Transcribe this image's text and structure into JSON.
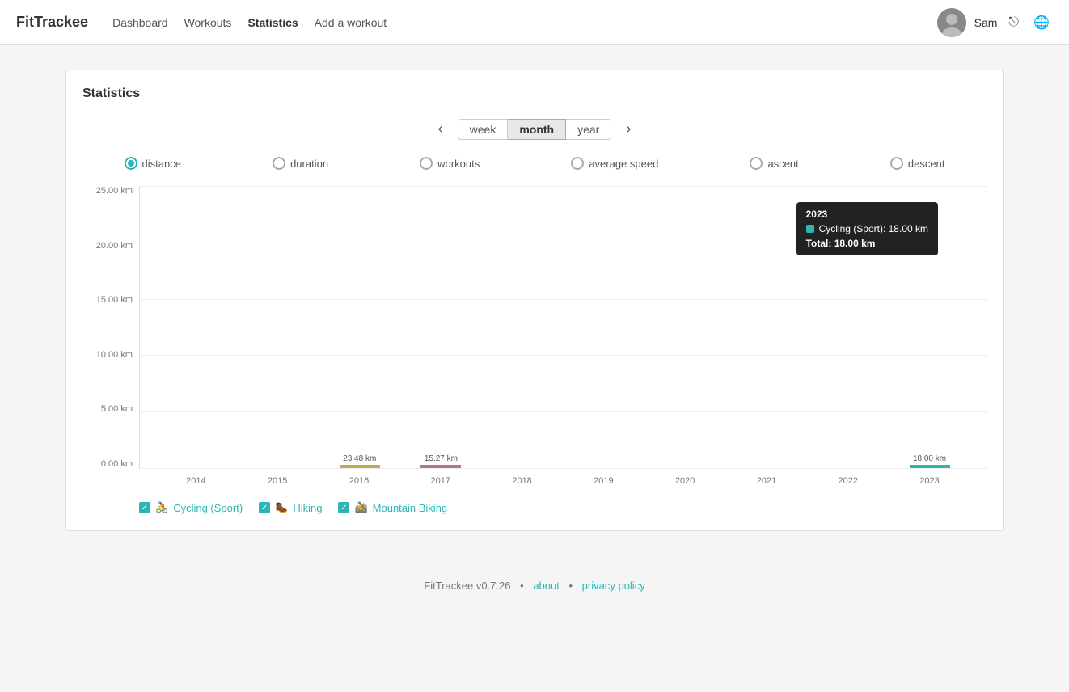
{
  "app": {
    "brand": "FitTrackee",
    "nav_links": [
      {
        "label": "Dashboard",
        "active": false
      },
      {
        "label": "Workouts",
        "active": false
      },
      {
        "label": "Statistics",
        "active": true
      },
      {
        "label": "Add a workout",
        "active": false
      }
    ],
    "user": "Sam"
  },
  "page": {
    "title": "Statistics"
  },
  "time_nav": {
    "prev_label": "‹",
    "next_label": "›",
    "buttons": [
      {
        "label": "week",
        "active": false
      },
      {
        "label": "month",
        "active": true
      },
      {
        "label": "year",
        "active": false
      }
    ]
  },
  "metrics": [
    {
      "id": "distance",
      "label": "distance",
      "selected": true
    },
    {
      "id": "duration",
      "label": "duration",
      "selected": false
    },
    {
      "id": "workouts",
      "label": "workouts",
      "selected": false
    },
    {
      "id": "average_speed",
      "label": "average speed",
      "selected": false
    },
    {
      "id": "ascent",
      "label": "ascent",
      "selected": false
    },
    {
      "id": "descent",
      "label": "descent",
      "selected": false
    }
  ],
  "chart": {
    "y_labels": [
      "25.00 km",
      "20.00 km",
      "15.00 km",
      "10.00 km",
      "5.00 km",
      "0.00 km"
    ],
    "x_labels": [
      "2014",
      "2015",
      "2016",
      "2017",
      "2018",
      "2019",
      "2020",
      "2021",
      "2022",
      "2023"
    ],
    "bars": [
      {
        "year": "2014",
        "value": 0,
        "color": "",
        "label": ""
      },
      {
        "year": "2015",
        "value": 0,
        "color": "",
        "label": ""
      },
      {
        "year": "2016",
        "value": 23.48,
        "color": "#c8a84b",
        "label": "23.48 km"
      },
      {
        "year": "2017",
        "value": 15.27,
        "color": "#b5748a",
        "label": "15.27 km"
      },
      {
        "year": "2018",
        "value": 0,
        "color": "",
        "label": ""
      },
      {
        "year": "2019",
        "value": 0,
        "color": "",
        "label": ""
      },
      {
        "year": "2020",
        "value": 0,
        "color": "",
        "label": ""
      },
      {
        "year": "2021",
        "value": 0,
        "color": "",
        "label": ""
      },
      {
        "year": "2022",
        "value": 0,
        "color": "",
        "label": ""
      },
      {
        "year": "2023",
        "value": 18,
        "color": "#2db5b5",
        "label": "18.00 km"
      }
    ],
    "max_value": 25,
    "tooltip": {
      "year": "2023",
      "rows": [
        {
          "color": "#2db5b5",
          "label": "Cycling (Sport): 18.00 km"
        }
      ],
      "total": "Total: 18.00 km"
    }
  },
  "legend": [
    {
      "label": "Cycling (Sport)",
      "color": "#2db5b5",
      "icon": "🚴"
    },
    {
      "label": "Hiking",
      "color": "#2db5b5",
      "icon": "🥾"
    },
    {
      "label": "Mountain Biking",
      "color": "#2db5b5",
      "icon": "🚵"
    }
  ],
  "footer": {
    "brand": "FitTrackee",
    "version": "v0.7.26",
    "about": "about",
    "privacy": "privacy policy"
  }
}
